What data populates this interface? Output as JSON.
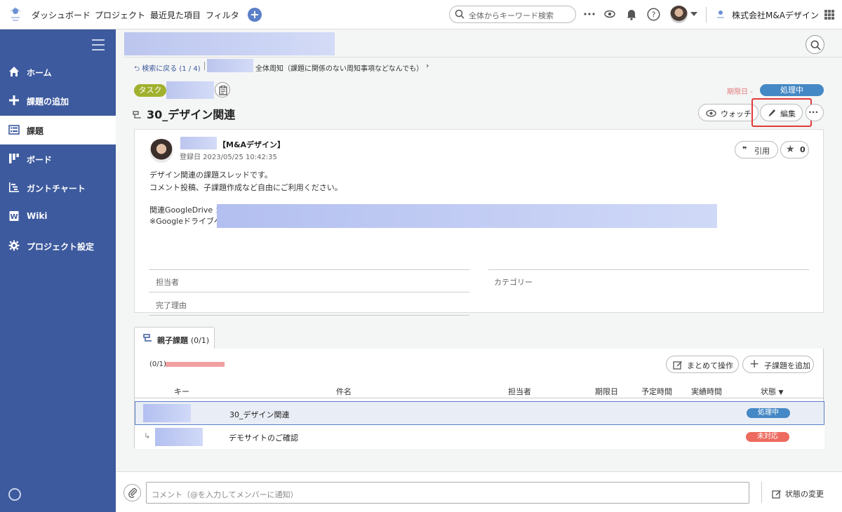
{
  "topbar": {
    "nav": [
      "ダッシュボード",
      "プロジェクト",
      "最近見た項目",
      "フィルタ"
    ],
    "add_icon": "plus-circle-icon",
    "search_placeholder": "全体からキーワード検索",
    "company": "株式会社M&Aデザイン"
  },
  "sidebar": {
    "items": [
      {
        "label": "ホーム",
        "icon": "home-icon"
      },
      {
        "label": "課題の追加",
        "icon": "plus-icon"
      },
      {
        "label": "課題",
        "icon": "list-icon",
        "active": true
      },
      {
        "label": "ボード",
        "icon": "board-icon"
      },
      {
        "label": "ガントチャート",
        "icon": "gantt-icon"
      },
      {
        "label": "Wiki",
        "icon": "wiki-icon"
      },
      {
        "label": "プロジェクト設定",
        "icon": "gear-icon"
      }
    ]
  },
  "breadcrumb": {
    "back": "検索に戻る (1 / 4)",
    "item": "全体周知（課題に関係のない周知事項などなんでも）"
  },
  "issue": {
    "type": "タスク",
    "due_label": "期限日 -",
    "status": "処理中",
    "title": "30_デザイン関連",
    "watch": "ウォッチ",
    "edit": "編集",
    "more": "•••"
  },
  "post": {
    "author": "【M&Aデザイン】",
    "registered": "登録日 2023/05/25 10:42:35",
    "quote": "引用",
    "star_count": "0",
    "lines": [
      "デザイン関連の課題スレッドです。",
      "コメント投稿、子課題作成など自由にご利用ください。",
      "関連GoogleDrive ：",
      "※Googleドライブへ"
    ],
    "fields": {
      "assignee": "担当者",
      "category": "カテゴリー",
      "resolution": "完了理由"
    }
  },
  "subtasks": {
    "tab_label": "親子課題",
    "tab_count": "(0/1)",
    "progress_label": "(0/1)",
    "progress": 0,
    "bulk": "まとめて操作",
    "add_child": "子課題を追加",
    "columns": [
      "キー",
      "件名",
      "担当者",
      "期限日",
      "予定時間",
      "実績時間",
      "状態"
    ],
    "rows": [
      {
        "subject": "30_デザイン関連",
        "status": "処理中",
        "status_color": "#4488c5"
      },
      {
        "subject": "デモサイトのご確認",
        "status": "未対応",
        "status_color": "#ed6a5e"
      }
    ]
  },
  "footer": {
    "comment_placeholder": "コメント（@を入力してメンバーに通知）",
    "status_change": "状態の変更"
  },
  "colors": {
    "sidebar": "#3d5a9e",
    "task_tag": "#a1b12e",
    "status_processing": "#4488c5",
    "status_open": "#ed6a5e",
    "highlight": "#e23a3a"
  }
}
